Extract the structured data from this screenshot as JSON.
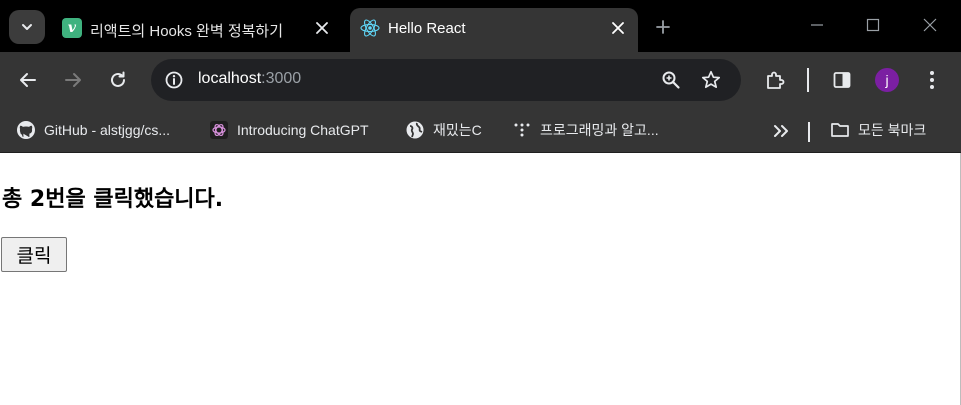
{
  "browser": {
    "tabs": [
      {
        "title": "리액트의 Hooks 완벽 정복하기",
        "favicon": "vue-icon",
        "active": false
      },
      {
        "title": "Hello React",
        "favicon": "react-icon",
        "active": true
      }
    ],
    "url": {
      "host": "localhost",
      "port": ":3000"
    },
    "profile_initial": "j",
    "bookmarks": [
      {
        "label": "GitHub - alstjgg/cs...",
        "icon": "github-icon"
      },
      {
        "label": "Introducing ChatGPT",
        "icon": "openai-icon"
      },
      {
        "label": "재밌는C",
        "icon": "globe-icon"
      },
      {
        "label": "프로그래밍과 알고...",
        "icon": "dots-icon"
      }
    ],
    "all_bookmarks_label": "모든 북마크",
    "colors": {
      "titlebar": "#000000",
      "toolbar": "#353535",
      "omnibox": "#202124",
      "avatar": "#7b1fa2",
      "vue": "#3fb27f",
      "react": "#61dafb"
    }
  },
  "page": {
    "count_text": "총 2번을 클릭했습니다.",
    "click_count": 2,
    "button_label": "클릭"
  }
}
